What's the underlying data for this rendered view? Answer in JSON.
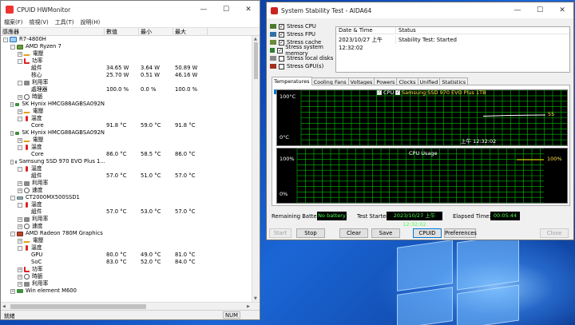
{
  "colors": {
    "graph_green": "#00c000",
    "graph_cpu_line": "#ffffff",
    "legend_yellow": "#ffd800",
    "status_green": "#4cff4c",
    "accent": "#0078d7"
  },
  "hwmonitor": {
    "title": "CPUID HWMonitor",
    "menu": [
      "檔案(F)",
      "檢視(V)",
      "工具(T)",
      "說明(H)"
    ],
    "columns": [
      "感應器",
      "數值",
      "最小",
      "最大"
    ],
    "status": "就緒",
    "num_indicator": "NUM",
    "rows": [
      {
        "indent": 0,
        "toggle": "-",
        "icon": "computer",
        "label": "R7-4800H",
        "v": "",
        "min": "",
        "max": ""
      },
      {
        "indent": 1,
        "toggle": "-",
        "icon": "cpu",
        "label": "AMD Ryzen 7",
        "v": "",
        "min": "",
        "max": ""
      },
      {
        "indent": 2,
        "toggle": "+",
        "icon": "volt",
        "label": "電壓",
        "v": "",
        "min": "",
        "max": ""
      },
      {
        "indent": 2,
        "toggle": "-",
        "icon": "power",
        "label": "功率",
        "v": "",
        "min": "",
        "max": ""
      },
      {
        "indent": 3,
        "toggle": "",
        "icon": "",
        "label": "組件",
        "v": "34.65 W",
        "min": "3.64 W",
        "max": "50.89 W"
      },
      {
        "indent": 3,
        "toggle": "",
        "icon": "",
        "label": "核心",
        "v": "25.70 W",
        "min": "0.51 W",
        "max": "46.16 W"
      },
      {
        "indent": 2,
        "toggle": "-",
        "icon": "util",
        "label": "利用率",
        "v": "",
        "min": "",
        "max": ""
      },
      {
        "indent": 3,
        "toggle": "",
        "icon": "",
        "label": "處理器",
        "v": "100.0 %",
        "min": "0.0 %",
        "max": "100.0 %"
      },
      {
        "indent": 2,
        "toggle": "+",
        "icon": "clock",
        "label": "時脈",
        "v": "",
        "min": "",
        "max": ""
      },
      {
        "indent": 1,
        "toggle": "-",
        "icon": "ram",
        "label": "SK Hynix HMCG88AGBSA092N",
        "v": "",
        "min": "",
        "max": ""
      },
      {
        "indent": 2,
        "toggle": "+",
        "icon": "volt",
        "label": "電壓",
        "v": "",
        "min": "",
        "max": ""
      },
      {
        "indent": 2,
        "toggle": "-",
        "icon": "temp",
        "label": "溫度",
        "v": "",
        "min": "",
        "max": ""
      },
      {
        "indent": 3,
        "toggle": "",
        "icon": "",
        "label": "Core",
        "v": "91.8 °C",
        "min": "59.0 °C",
        "max": "91.8 °C"
      },
      {
        "indent": 1,
        "toggle": "-",
        "icon": "ram",
        "label": "SK Hynix HMCG88AGBSA092N",
        "v": "",
        "min": "",
        "max": ""
      },
      {
        "indent": 2,
        "toggle": "+",
        "icon": "volt",
        "label": "電壓",
        "v": "",
        "min": "",
        "max": ""
      },
      {
        "indent": 2,
        "toggle": "-",
        "icon": "temp",
        "label": "溫度",
        "v": "",
        "min": "",
        "max": ""
      },
      {
        "indent": 3,
        "toggle": "",
        "icon": "",
        "label": "Core",
        "v": "86.0 °C",
        "min": "58.5 °C",
        "max": "86.0 °C"
      },
      {
        "indent": 1,
        "toggle": "-",
        "icon": "disk",
        "label": "Samsung SSD 970 EVO Plus 1...",
        "v": "",
        "min": "",
        "max": ""
      },
      {
        "indent": 2,
        "toggle": "-",
        "icon": "temp",
        "label": "溫度",
        "v": "",
        "min": "",
        "max": ""
      },
      {
        "indent": 3,
        "toggle": "",
        "icon": "",
        "label": "組件",
        "v": "57.0 °C",
        "min": "51.0 °C",
        "max": "57.0 °C"
      },
      {
        "indent": 2,
        "toggle": "+",
        "icon": "util",
        "label": "利用率",
        "v": "",
        "min": "",
        "max": ""
      },
      {
        "indent": 2,
        "toggle": "+",
        "icon": "clock",
        "label": "速度",
        "v": "",
        "min": "",
        "max": ""
      },
      {
        "indent": 1,
        "toggle": "-",
        "icon": "disk",
        "label": "CT2000MX500SSD1",
        "v": "",
        "min": "",
        "max": ""
      },
      {
        "indent": 2,
        "toggle": "-",
        "icon": "temp",
        "label": "溫度",
        "v": "",
        "min": "",
        "max": ""
      },
      {
        "indent": 3,
        "toggle": "",
        "icon": "",
        "label": "組件",
        "v": "57.0 °C",
        "min": "53.0 °C",
        "max": "57.0 °C"
      },
      {
        "indent": 2,
        "toggle": "+",
        "icon": "util",
        "label": "利用率",
        "v": "",
        "min": "",
        "max": ""
      },
      {
        "indent": 2,
        "toggle": "+",
        "icon": "clock",
        "label": "速度",
        "v": "",
        "min": "",
        "max": ""
      },
      {
        "indent": 1,
        "toggle": "-",
        "icon": "gpu",
        "label": "AMD Radeon 780M Graphics",
        "v": "",
        "min": "",
        "max": ""
      },
      {
        "indent": 2,
        "toggle": "+",
        "icon": "volt",
        "label": "電壓",
        "v": "",
        "min": "",
        "max": ""
      },
      {
        "indent": 2,
        "toggle": "-",
        "icon": "temp",
        "label": "溫度",
        "v": "",
        "min": "",
        "max": ""
      },
      {
        "indent": 3,
        "toggle": "",
        "icon": "",
        "label": "GPU",
        "v": "80.0 °C",
        "min": "49.0 °C",
        "max": "81.0 °C"
      },
      {
        "indent": 3,
        "toggle": "",
        "icon": "",
        "label": "SoC",
        "v": "83.0 °C",
        "min": "52.0 °C",
        "max": "84.0 °C"
      },
      {
        "indent": 2,
        "toggle": "+",
        "icon": "power",
        "label": "功率",
        "v": "",
        "min": "",
        "max": ""
      },
      {
        "indent": 2,
        "toggle": "+",
        "icon": "clock",
        "label": "時脈",
        "v": "",
        "min": "",
        "max": ""
      },
      {
        "indent": 2,
        "toggle": "+",
        "icon": "util",
        "label": "利用率",
        "v": "",
        "min": "",
        "max": ""
      },
      {
        "indent": 1,
        "toggle": "+",
        "icon": "mb",
        "label": "Win element M600",
        "v": "",
        "min": "",
        "max": ""
      }
    ]
  },
  "aida": {
    "title": "System Stability Test - AIDA64",
    "stress": [
      {
        "label": "Stress CPU",
        "checked": true,
        "icon": "cpu"
      },
      {
        "label": "Stress FPU",
        "checked": true,
        "icon": "fpu"
      },
      {
        "label": "Stress cache",
        "checked": true,
        "icon": "cache"
      },
      {
        "label": "Stress system memory",
        "checked": true,
        "icon": "ram"
      },
      {
        "label": "Stress local disks",
        "checked": false,
        "icon": "disk"
      },
      {
        "label": "Stress GPU(s)",
        "checked": false,
        "icon": "gpu"
      }
    ],
    "status_head": {
      "date": "Date & Time",
      "status": "Status"
    },
    "status_row": {
      "date": "2023/10/27 上午 12:32:02",
      "status": "Stability Test: Started"
    },
    "tabs": [
      "Temperatures",
      "Cooling Fans",
      "Voltages",
      "Powers",
      "Clocks",
      "Unified",
      "Statistics"
    ],
    "active_tab": 0,
    "temp_graph": {
      "y_top": "100°C",
      "y_bottom": "0°C",
      "legend_cpu": "CPU",
      "legend_ssd": "Samsung SSD 970 EVO Plus 1TB",
      "time": "上午 12:32:02",
      "value_label": "55",
      "value": 55,
      "ymax": 100
    },
    "cpu_graph": {
      "title": "CPU Usage",
      "y_top_left": "100%",
      "y_bottom_left": "0%",
      "y_top_right": "100%",
      "value": 100
    },
    "info": {
      "battery_label": "Remaining Battery:",
      "battery_value": "No battery",
      "started_label": "Test Started:",
      "started_value": "2023/10/27 上午 12:32:02",
      "elapsed_label": "Elapsed Time:",
      "elapsed_value": "00:05:44"
    },
    "buttons": {
      "start": "Start",
      "stop": "Stop",
      "clear": "Clear",
      "save": "Save",
      "cpuid": "CPUID",
      "preferences": "Preferences",
      "close": "Close"
    }
  }
}
